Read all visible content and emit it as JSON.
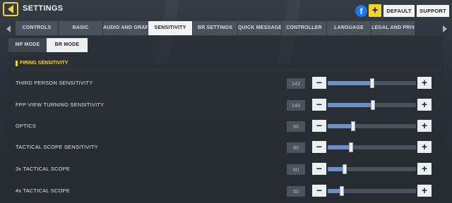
{
  "header": {
    "title": "SETTINGS",
    "facebook_letter": "f",
    "plus_label": "+",
    "default_label": "DEFAULT",
    "support_label": "SUPPORT"
  },
  "tabs": [
    {
      "label": "CONTROLS",
      "active": false
    },
    {
      "label": "BASIC",
      "active": false
    },
    {
      "label": "AUDIO AND GRAPHICS",
      "active": false
    },
    {
      "label": "SENSITIVITY",
      "active": true
    },
    {
      "label": "BR SETTINGS",
      "active": false
    },
    {
      "label": "QUICK MESSAGE",
      "active": false
    },
    {
      "label": "CONTROLLER",
      "active": false
    },
    {
      "label": "LANGUAGE",
      "active": false
    },
    {
      "label": "LEGAL AND PRIVACY",
      "active": false
    }
  ],
  "modes": {
    "mp_label": "MP MODE",
    "br_label": "BR MODE",
    "active": "BR MODE"
  },
  "section": {
    "title": "FIRING SENSITIVITY"
  },
  "settings": [
    {
      "label": "THIRD PERSON SENSITIVITY",
      "value": "142",
      "fill_fraction": 0.5
    },
    {
      "label": "FPP VIEW TURNING SENSITIVITY",
      "value": "146",
      "fill_fraction": 0.51
    },
    {
      "label": "OPTICS",
      "value": "90",
      "fill_fraction": 0.29
    },
    {
      "label": "TACTICAL SCOPE SENSITIVITY",
      "value": "80",
      "fill_fraction": 0.26
    },
    {
      "label": "3x TACTICAL SCOPE",
      "value": "60",
      "fill_fraction": 0.19
    },
    {
      "label": "4x TACTICAL SCOPE",
      "value": "50",
      "fill_fraction": 0.16
    }
  ],
  "steppers": {
    "minus": "−",
    "plus": "+"
  },
  "colors": {
    "accent_yellow": "#f1d33b",
    "slider_fill": "#6d8fc5",
    "facebook_blue": "#1877f2"
  }
}
